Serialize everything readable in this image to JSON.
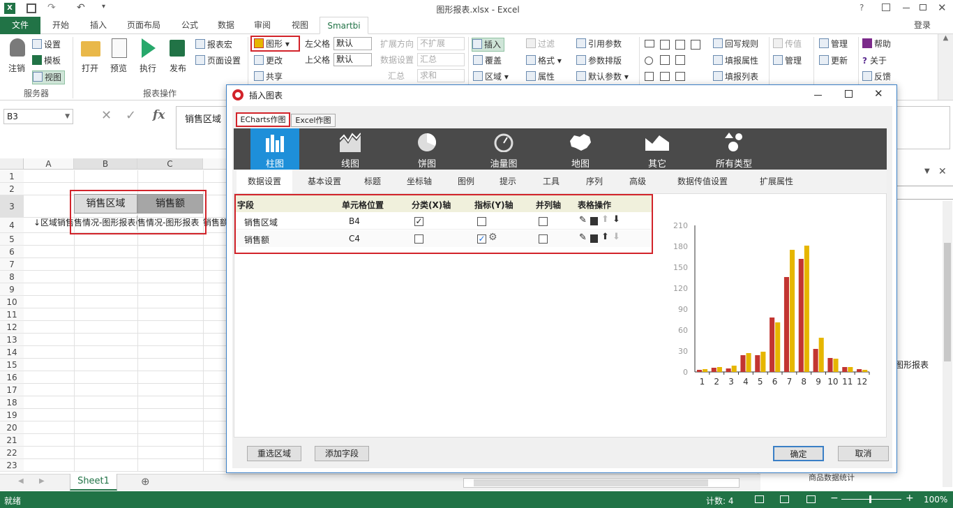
{
  "window": {
    "title": "图形报表.xlsx - Excel",
    "help": "?",
    "login": "登录"
  },
  "tabs": [
    "文件",
    "开始",
    "插入",
    "页面布局",
    "公式",
    "数据",
    "审阅",
    "视图",
    "Smartbi"
  ],
  "ribbon": {
    "server": {
      "logout": "注销",
      "settings": "设置",
      "template": "模板",
      "view": "视图",
      "group": "服务器"
    },
    "report": {
      "open": "打开",
      "preview": "预览",
      "execute": "执行",
      "publish": "发布",
      "macro": "报表宏",
      "page_setup": "页面设置",
      "group": "报表操作"
    },
    "chart": {
      "graph": "图形",
      "change": "更改",
      "share": "共享"
    },
    "parent": {
      "left": "左父格",
      "left_val": "默认",
      "top": "上父格",
      "top_val": "默认"
    },
    "expand": {
      "dir": "扩展方向",
      "dir_val": "不扩展",
      "data": "数据设置",
      "data_val": "汇总",
      "sum": "汇总",
      "sum_val": "求和"
    },
    "insert": {
      "insert": "插入",
      "cover": "覆盖",
      "area": "区域"
    },
    "filter": {
      "filter": "过滤",
      "format": "格式",
      "attr": "属性"
    },
    "params": {
      "ref": "引用参数",
      "layout": "参数排版",
      "default": "默认参数"
    },
    "writeback": {
      "rule": "回写规则",
      "fill_attr": "填报属性",
      "fill_list": "填报列表"
    },
    "misc": {
      "transfer": "传值",
      "manage": "管理",
      "manage2": "管理",
      "update": "更新",
      "help": "帮助",
      "about": "关于",
      "feedback": "反馈"
    }
  },
  "formula": {
    "namebox": "B3",
    "fx": "fx",
    "content": "销售区域"
  },
  "grid": {
    "cols": [
      "A",
      "B",
      "C"
    ],
    "rows": [
      "1",
      "2",
      "3",
      "4",
      "5",
      "6",
      "7",
      "8",
      "9",
      "10",
      "11",
      "12",
      "13",
      "14",
      "15",
      "16",
      "17",
      "18",
      "19",
      "20",
      "21",
      "22",
      "23"
    ],
    "b3": "销售区域",
    "c3": "销售额",
    "a4": "↓区域销售",
    "b4": "售情况-图形报表(",
    "c4": "售情况-图形报表",
    "d4": "销售额"
  },
  "sheet": {
    "tab": "Sheet1",
    "add": "⊕"
  },
  "status": {
    "ready": "就绪",
    "count": "计数: 4",
    "zoom": "100%"
  },
  "rightpane": {
    "item": "图形报表",
    "tree": "商品数据统计"
  },
  "dialog": {
    "title": "插入图表",
    "toptabs": [
      "ECharts作图",
      "Excel作图"
    ],
    "types": [
      "柱图",
      "线图",
      "饼图",
      "油量图",
      "地图",
      "其它",
      "所有类型"
    ],
    "subtabs": [
      "数据设置",
      "基本设置",
      "标题",
      "坐标轴",
      "图例",
      "提示",
      "工具",
      "序列",
      "高级",
      "数据传值设置",
      "扩展属性"
    ],
    "table": {
      "headers": [
        "字段",
        "单元格位置",
        "分类(X)轴",
        "指标(Y)轴",
        "并列轴",
        "表格操作"
      ],
      "rows": [
        {
          "field": "销售区域",
          "cell": "B4",
          "x": true,
          "y": false,
          "parallel": false
        },
        {
          "field": "销售额",
          "cell": "C4",
          "x": false,
          "y": true,
          "parallel": false
        }
      ]
    },
    "buttons": {
      "reselect": "重选区域",
      "add_field": "添加字段",
      "ok": "确定",
      "cancel": "取消"
    }
  },
  "chart_data": {
    "type": "bar",
    "categories": [
      "1",
      "2",
      "3",
      "4",
      "5",
      "6",
      "7",
      "8",
      "9",
      "10",
      "11",
      "12"
    ],
    "series": [
      {
        "values": [
          3,
          6,
          5,
          24,
          24,
          78,
          136,
          162,
          33,
          20,
          7,
          4
        ],
        "color": "#c23531"
      },
      {
        "values": [
          4,
          7,
          9,
          27,
          29,
          71,
          175,
          181,
          49,
          19,
          7,
          3
        ],
        "color": "#e6b600"
      }
    ],
    "yticks": [
      "0",
      "30",
      "60",
      "90",
      "120",
      "150",
      "180",
      "210"
    ],
    "ylim": [
      0,
      210
    ]
  }
}
